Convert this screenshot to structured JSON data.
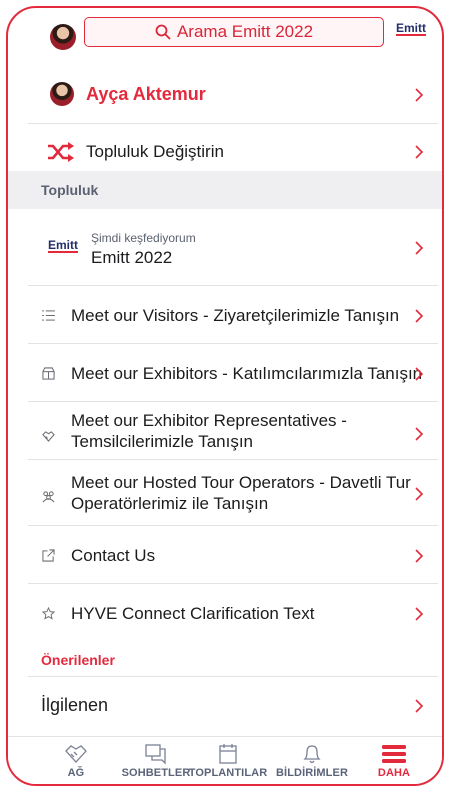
{
  "header": {
    "search_placeholder": "Arama Emitt 2022",
    "brand": "Emitt"
  },
  "profile": {
    "name": "Ayça Aktemur"
  },
  "switch_community": {
    "label": "Topluluk Değiştirin"
  },
  "sections": {
    "community": "Topluluk",
    "suggested": "Önerilenler"
  },
  "current_event": {
    "caption": "Şimdi keşfediyorum",
    "name": "Emitt 2022",
    "logo": "Emitt"
  },
  "menu": [
    {
      "label": "Meet our Visitors - Ziyaretçilerimizle Tanışın",
      "icon": "list-icon"
    },
    {
      "label": "Meet our Exhibitors - Katılımcılarımızla Tanışın",
      "icon": "booth-icon"
    },
    {
      "label_line1": "Meet our Exhibitor Representatives -",
      "label_line2": "Temsilcilerimizle Tanışın",
      "icon": "handshake-icon"
    },
    {
      "label_line1": "Meet our Hosted Tour Operators - Davetli Tur",
      "label_line2": "Operatörlerimiz ile Tanışın",
      "icon": "group-icon"
    },
    {
      "label": "Contact Us",
      "icon": "external-link-icon"
    },
    {
      "label": "HYVE Connect Clarification Text",
      "icon": "star-icon"
    }
  ],
  "suggested": {
    "item": "İlgilenen"
  },
  "tabs": [
    {
      "label": "AĞ",
      "icon": "handshake-icon",
      "active": false
    },
    {
      "label": "SOHBETLER",
      "icon": "chat-icon",
      "active": false
    },
    {
      "label": "TOPLANTILAR",
      "icon": "calendar-icon",
      "active": false
    },
    {
      "label": "BİLDİRİMLER",
      "icon": "bell-icon",
      "active": false
    },
    {
      "label": "DAHA",
      "icon": "menu-icon",
      "active": true
    }
  ],
  "colors": {
    "accent": "#e32a3d",
    "section_bg": "#efeff1",
    "brand_navy": "#24306b"
  }
}
